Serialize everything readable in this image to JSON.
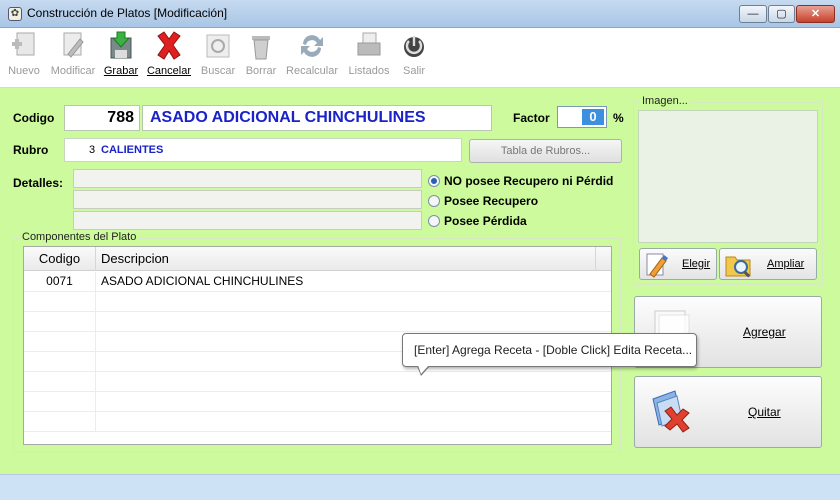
{
  "window": {
    "title": "Construcción de Platos [Modificación]",
    "buttons": {
      "minimize": "—",
      "maximize": "▢",
      "close": "✕"
    }
  },
  "toolbar": {
    "nuevo": "Nuevo",
    "modificar": "Modificar",
    "grabar": "Grabar",
    "cancelar": "Cancelar",
    "buscar": "Buscar",
    "borrar": "Borrar",
    "recalcular": "Recalcular",
    "listados": "Listados",
    "salir": "Salir"
  },
  "form": {
    "codigo_label": "Codigo",
    "codigo_value": "788",
    "descripcion_value": "ASADO ADICIONAL CHINCHULINES",
    "factor_label": "Factor",
    "factor_value": "0",
    "factor_unit": "%",
    "rubro_label": "Rubro",
    "rubro_code": "3",
    "rubro_name": "CALIENTES",
    "tabla_rubros_button": "Tabla de Rubros...",
    "detalles_label": "Detalles:",
    "detalles": [
      "",
      "",
      ""
    ],
    "recupero_options": [
      {
        "label": "NO posee Recupero ni Pérdid",
        "selected": true
      },
      {
        "label": "Posee Recupero",
        "selected": false
      },
      {
        "label": "Posee Pérdida",
        "selected": false
      }
    ]
  },
  "componentes": {
    "group_title": "Componentes del Plato",
    "columns": {
      "codigo": "Codigo",
      "descripcion": "Descripcion"
    },
    "rows": [
      {
        "codigo": "0071",
        "descripcion": "ASADO ADICIONAL CHINCHULINES"
      }
    ]
  },
  "tooltip": "[Enter] Agrega Receta - [Doble Click] Edita Receta...",
  "imagen": {
    "group_title": "Imagen...",
    "elegir_button": "Elegir",
    "ampliar_button": "Ampliar"
  },
  "actions": {
    "agregar_button": "Agregar",
    "quitar_button": "Quitar"
  },
  "colors": {
    "form_background": "#ccfa9c",
    "description_text": "#1a22c8",
    "factor_highlight": "#3d8fe0"
  }
}
